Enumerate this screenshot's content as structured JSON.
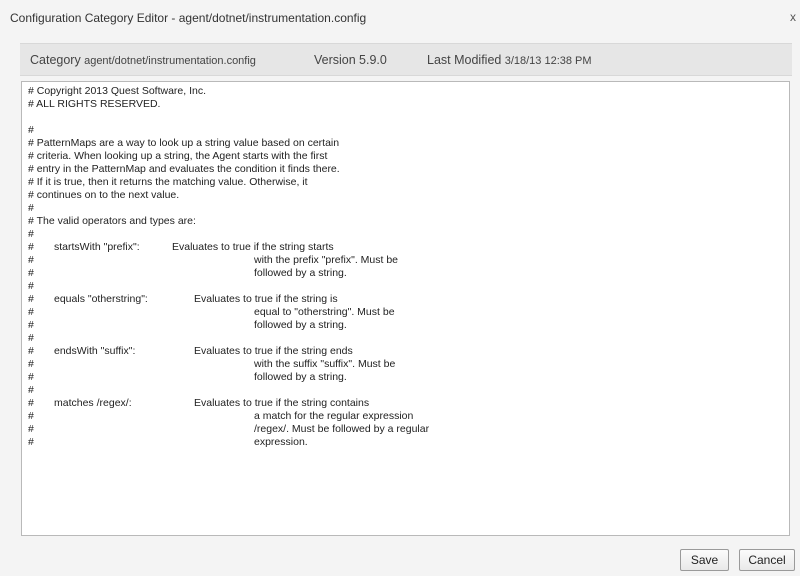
{
  "window": {
    "title": "Configuration Category Editor - agent/dotnet/instrumentation.config",
    "close_glyph": "x"
  },
  "info": {
    "category_label": "Category",
    "category_value": "agent/dotnet/instrumentation.config",
    "version_label": "Version",
    "version_value": "5.9.0",
    "modified_label": "Last Modified",
    "modified_value": "3/18/13 12:38 PM"
  },
  "editor": {
    "lines": [
      {
        "a": "# Copyright 2013 Quest Software, Inc.",
        "b": "",
        "c": "",
        "cpos": 0
      },
      {
        "a": "# ALL RIGHTS RESERVED.",
        "b": "",
        "c": "",
        "cpos": 0
      },
      {
        "a": "",
        "b": "",
        "c": "",
        "cpos": 0
      },
      {
        "a": "#",
        "b": "",
        "c": "",
        "cpos": 0
      },
      {
        "a": "# PatternMaps are a way to look up a string value based on certain",
        "b": "",
        "c": "",
        "cpos": 0
      },
      {
        "a": "# criteria.  When looking up a string, the Agent starts with the first",
        "b": "",
        "c": "",
        "cpos": 0
      },
      {
        "a": "# entry in the PatternMap and evaluates the condition it finds there.",
        "b": "",
        "c": "",
        "cpos": 0
      },
      {
        "a": "# If it is true, then it returns the matching value.  Otherwise, it",
        "b": "",
        "c": "",
        "cpos": 0
      },
      {
        "a": "# continues on to the next value.",
        "b": "",
        "c": "",
        "cpos": 0
      },
      {
        "a": "#",
        "b": "",
        "c": "",
        "cpos": 0
      },
      {
        "a": "# The valid operators and types are:",
        "b": "",
        "c": "",
        "cpos": 0
      },
      {
        "a": "#",
        "b": "",
        "c": "",
        "cpos": 0
      },
      {
        "a": "#",
        "b": "startsWith \"prefix\":",
        "c": "Evaluates to true if the string starts",
        "cpos": 1
      },
      {
        "a": "#",
        "b": "",
        "c": "with the prefix \"prefix\".  Must be",
        "cpos": 2
      },
      {
        "a": "#",
        "b": "",
        "c": "followed by a string.",
        "cpos": 2
      },
      {
        "a": "#",
        "b": "",
        "c": "",
        "cpos": 0
      },
      {
        "a": "#",
        "b": "equals \"otherstring\":",
        "c": "Evaluates to true if the string is",
        "cpos": 3
      },
      {
        "a": "#",
        "b": "",
        "c": "equal to \"otherstring\".  Must be",
        "cpos": 2
      },
      {
        "a": "#",
        "b": "",
        "c": "followed by a string.",
        "cpos": 2
      },
      {
        "a": "#",
        "b": "",
        "c": "",
        "cpos": 0
      },
      {
        "a": "#",
        "b": "endsWith \"suffix\":",
        "c": "Evaluates to true if the string ends",
        "cpos": 3
      },
      {
        "a": "#",
        "b": "",
        "c": "with the suffix \"suffix\".  Must be",
        "cpos": 2
      },
      {
        "a": "#",
        "b": "",
        "c": "followed by a string.",
        "cpos": 2
      },
      {
        "a": "#",
        "b": "",
        "c": "",
        "cpos": 0
      },
      {
        "a": "#",
        "b": "matches /regex/:",
        "c": "Evaluates to true if the string contains",
        "cpos": 3
      },
      {
        "a": "#",
        "b": "",
        "c": "a match for the regular expression",
        "cpos": 2
      },
      {
        "a": "#",
        "b": "",
        "c": "/regex/.  Must be followed by a regular",
        "cpos": 2
      },
      {
        "a": "#",
        "b": "",
        "c": "expression.",
        "cpos": 2
      }
    ]
  },
  "footer": {
    "save_label": "Save",
    "cancel_label": "Cancel"
  }
}
